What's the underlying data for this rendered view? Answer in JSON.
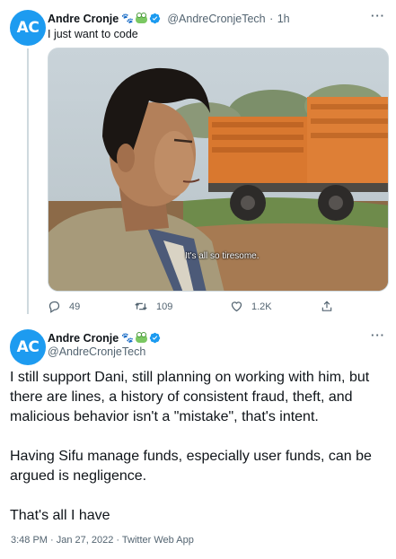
{
  "reply": {
    "avatar_initials": "AC",
    "author_name": "Andre Cronje",
    "handle": "@AndreCronjeTech",
    "separator": "·",
    "time": "1h",
    "text": "I just want to code",
    "media": {
      "subtitle": "It's all so tiresome."
    },
    "actions": {
      "replies": "49",
      "retweets": "109",
      "likes": "1.2K"
    }
  },
  "main": {
    "avatar_initials": "AC",
    "author_name": "Andre Cronje",
    "handle": "@AndreCronjeTech",
    "paragraphs": [
      "I still support Dani, still planning on working with him, but there are lines, a history of consistent fraud, theft, and malicious behavior isn't a \"mistake\", that's intent.",
      "Having Sifu manage funds, especially user funds, can be argued is negligence.",
      "That's all I have"
    ],
    "meta": "3:48 PM · Jan 27, 2022 · Twitter Web App"
  },
  "icons": [
    "paw-emoji-icon",
    "frog-emoji-icon",
    "verified-badge-icon",
    "more-icon",
    "reply-icon",
    "retweet-icon",
    "like-icon",
    "share-icon"
  ],
  "colors": {
    "avatar": "#1d9bf0",
    "verified": "#1d9bf0",
    "secondary_text": "#536471",
    "thread_line": "#cfd9de"
  }
}
